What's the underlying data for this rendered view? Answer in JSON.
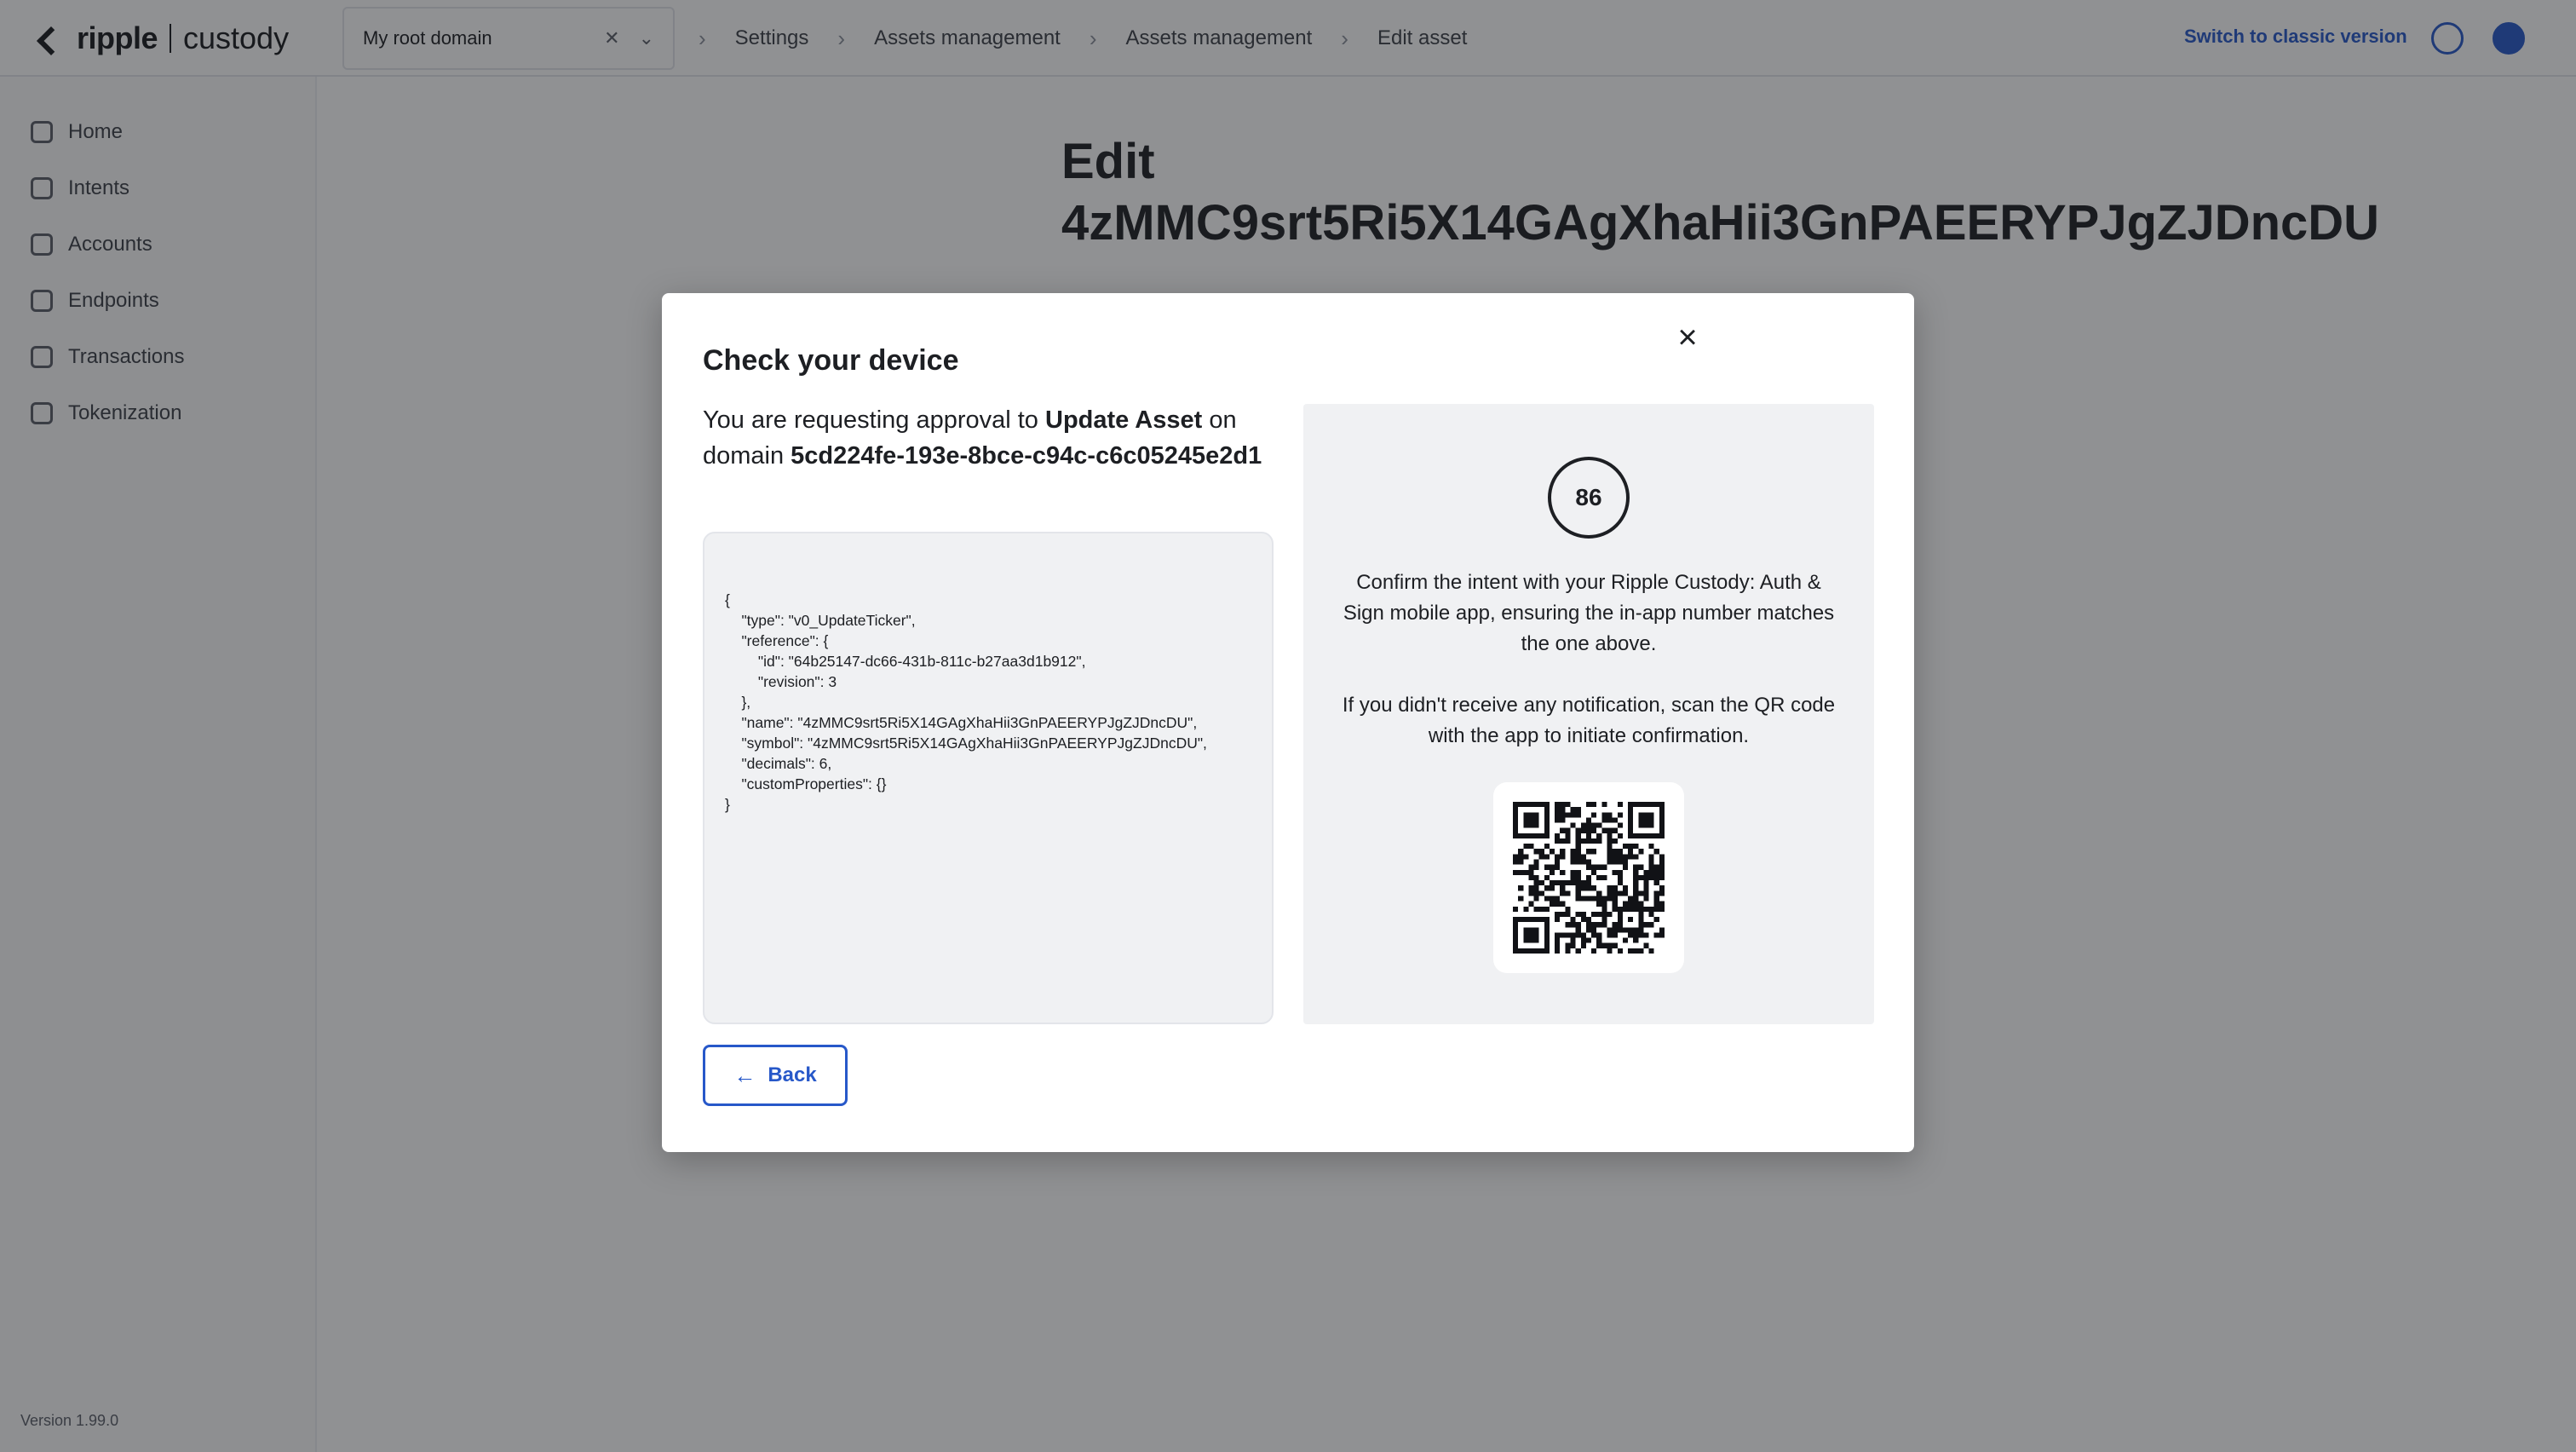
{
  "header": {
    "logo_text": "ripple",
    "logo_subtext": "custody",
    "domain_value": "My root domain",
    "domain_clear_icon": "close-icon",
    "domain_chevron_icon": "chevron-down-icon",
    "breadcrumbs": [
      "Settings",
      "Assets management",
      "Assets management",
      "Edit asset"
    ],
    "switch_link": "Switch to classic version",
    "help_icon": "help-icon",
    "user_icon": "user-icon"
  },
  "sidebar": {
    "items": [
      {
        "label": "Home",
        "icon": "home-icon"
      },
      {
        "label": "Intents",
        "icon": "intents-icon"
      },
      {
        "label": "Accounts",
        "icon": "accounts-icon"
      },
      {
        "label": "Endpoints",
        "icon": "endpoints-icon"
      },
      {
        "label": "Transactions",
        "icon": "transactions-icon"
      },
      {
        "label": "Tokenization",
        "icon": "tokenization-icon"
      }
    ],
    "version": "Version 1.99.0"
  },
  "page": {
    "title_line1": "Edit",
    "title_line2": "4zMMC9srt5Ri5X14GAgXhaHii3GnPAEERYPJgZJDncDU"
  },
  "modal": {
    "title": "Check your device",
    "request_prefix": "You are requesting approval to ",
    "action": "Update Asset",
    "request_middle": " on domain ",
    "domain_id": "5cd224fe-193e-8bce-c94c-c6c05245e2d1",
    "payload": "{\n    \"type\": \"v0_UpdateTicker\",\n    \"reference\": {\n        \"id\": \"64b25147-dc66-431b-811c-b27aa3d1b912\",\n        \"revision\": 3\n    },\n    \"name\": \"4zMMC9srt5Ri5X14GAgXhaHii3GnPAEERYPJgZJDncDU\",\n    \"symbol\": \"4zMMC9srt5Ri5X14GAgXhaHii3GnPAEERYPJgZJDncDU\",\n    \"decimals\": 6,\n    \"customProperties\": {}\n}",
    "verification_code": "86",
    "confirm_message": "Confirm the intent with your Ripple Custody: Auth & Sign mobile app, ensuring the in-app number matches the one above.",
    "scan_message": "If you didn't receive any notification, scan the QR code with the app to initiate confirmation.",
    "qr_icon": "qr-code",
    "back_label": "Back",
    "back_icon": "arrow-left-icon",
    "close_icon": "close-icon"
  },
  "colors": {
    "accent": "#2758c9",
    "overlay": "#181a1e",
    "panel_bg": "#f0f1f3"
  }
}
